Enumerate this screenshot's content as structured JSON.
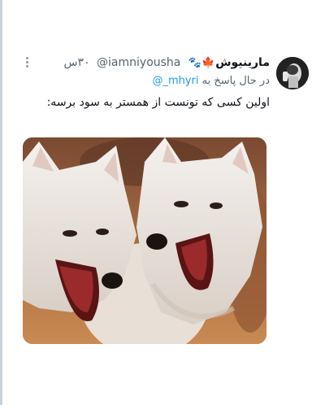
{
  "tweet": {
    "display_name": "مارینیوش",
    "name_emojis": "🍁🐾",
    "handle": "@iamniyousha",
    "time": "۳۰س",
    "reply_prefix": "در حال پاسخ به",
    "reply_to": "@_mhyri",
    "text": "اولین کسی که تونست از همستر به سود برسه:",
    "media": {
      "description_icon": "laughing-wolves-photo"
    }
  },
  "colors": {
    "text": "#0f1419",
    "secondary": "#536471",
    "link": "#1d9bf0"
  }
}
